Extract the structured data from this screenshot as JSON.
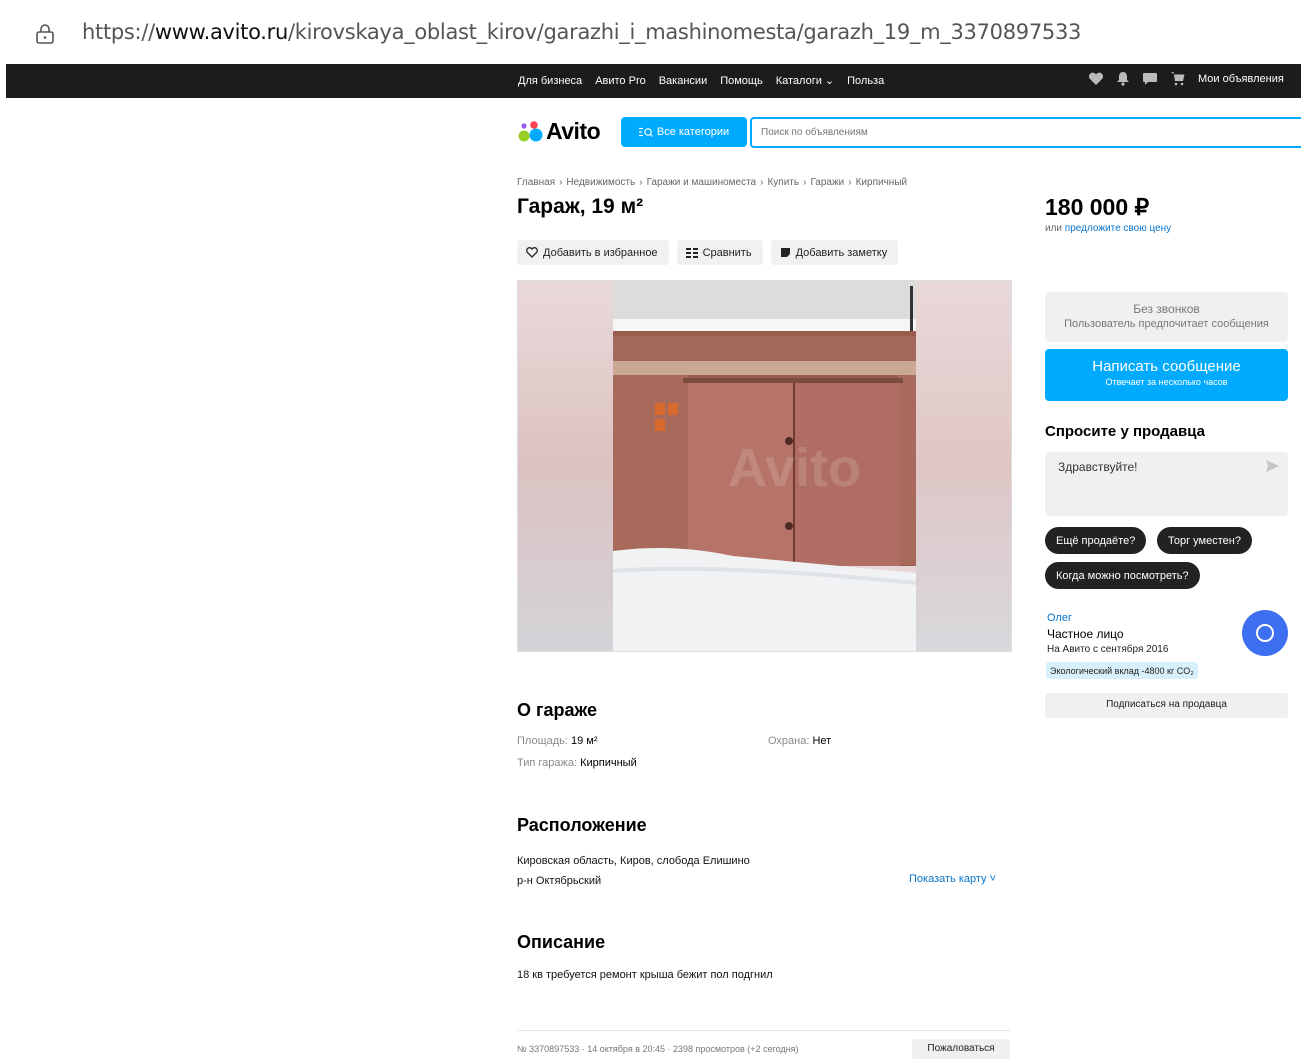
{
  "browser": {
    "url_prefix": "https://",
    "url_domain": "www.avito.ru",
    "url_path": "/kirovskaya_oblast_kirov/garazhi_i_mashinomesta/garazh_19_m_3370897533"
  },
  "topnav": {
    "links": [
      "Для бизнеса",
      "Авито Pro",
      "Вакансии",
      "Помощь",
      "Каталоги ⌄",
      "Польза"
    ],
    "my_ads": "Мои объявления"
  },
  "header": {
    "logo_text": "Avito",
    "categories_label": "Все категории",
    "search_placeholder": "Поиск по объявлениям"
  },
  "breadcrumbs": [
    "Главная",
    "Недвижимость",
    "Гаражи и машиноместа",
    "Купить",
    "Гаражи",
    "Кирпичный"
  ],
  "listing": {
    "title": "Гараж, 19 м²",
    "actions": {
      "favorite": "Добавить в избранное",
      "compare": "Сравнить",
      "note": "Добавить заметку"
    },
    "photo_watermark": "Avito"
  },
  "sidebar": {
    "price": "180 000 ₽",
    "offer_prefix": "или ",
    "offer_link": "предложите свою цену",
    "no_calls_title": "Без звонков",
    "no_calls_sub": "Пользователь предпочитает сообщения",
    "write_btn": "Написать сообщение",
    "write_sub": "Отвечает за несколько часов",
    "ask_title": "Спросите у продавца",
    "message_text": "Здравствуйте!",
    "quick_replies": [
      "Ещё продаёте?",
      "Торг уместен?",
      "Когда можно посмотреть?"
    ],
    "seller_name": "Олег",
    "seller_type": "Частное лицо",
    "seller_since": "На Авито с сентября 2016",
    "eco": "Экологический вклад -4800 кг CO₂",
    "subscribe": "Подписаться на продавца"
  },
  "about": {
    "title": "О гараже",
    "area_key": "Площадь: ",
    "area_val": "19 м²",
    "security_key": "Охрана: ",
    "security_val": "Нет",
    "type_key": "Тип гаража: ",
    "type_val": "Кирпичный"
  },
  "location": {
    "title": "Расположение",
    "address": "Кировская область, Киров, слобода Елишино",
    "district": " р-н Октябрьский",
    "show_map": "Показать карту ˅"
  },
  "description": {
    "title": "Описание",
    "text": "18 кв требуется ремонт крыша бежит пол подгнил"
  },
  "footer": {
    "info": "№ 3370897533 · 14 октября в 20:45 · 2398 просмотров (+2 сегодня)",
    "report": "Пожаловаться"
  },
  "colors": {
    "accent": "#00aaff",
    "link": "#0a74c9",
    "topbar": "#1c1c1c",
    "fab": "#3d6ff0"
  }
}
